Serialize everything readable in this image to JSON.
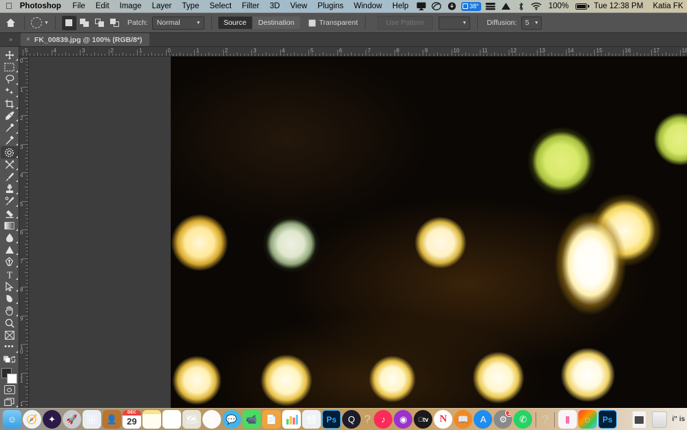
{
  "menubar": {
    "apple_icon": "apple-icon",
    "items": [
      {
        "label": "Photoshop",
        "bold": true
      },
      {
        "label": "File"
      },
      {
        "label": "Edit"
      },
      {
        "label": "Image"
      },
      {
        "label": "Layer"
      },
      {
        "label": "Type"
      },
      {
        "label": "Select"
      },
      {
        "label": "Filter"
      },
      {
        "label": "3D"
      },
      {
        "label": "View"
      },
      {
        "label": "Plugins"
      },
      {
        "label": "Window"
      },
      {
        "label": "Help"
      }
    ],
    "status": {
      "airplay_icon": "airplay-icon",
      "creative_cloud_icon": "creative-cloud-icon",
      "dropbox_icon": "dropbox-icon",
      "temperature": "38°",
      "temperature_color": "#1877e0",
      "stack_icon": "stack-icon",
      "onedrive_icon": "onedrive-icon",
      "bluetooth_icon": "bluetooth-icon",
      "wifi_icon": "wifi-icon",
      "battery_percent": "100%",
      "battery_icon": "battery-charging-icon",
      "clock": "Tue 12:38 PM",
      "user": "Katia FK",
      "search_icon": "search-icon",
      "control_center_icon": "control-center-icon"
    }
  },
  "options_bar": {
    "home_icon": "home-icon",
    "tool_preset": "patch-tool-preset",
    "selection_modes": [
      {
        "name": "new-selection",
        "active": true
      },
      {
        "name": "add-to-selection",
        "active": false
      },
      {
        "name": "subtract-from-selection",
        "active": false
      },
      {
        "name": "intersect-with-selection",
        "active": false
      }
    ],
    "patch_label": "Patch:",
    "patch_value": "Normal",
    "source_label": "Source",
    "destination_label": "Destination",
    "source_active": true,
    "transparent_label": "Transparent",
    "transparent_checked": false,
    "use_pattern_label": "Use Pattern",
    "use_pattern_enabled": false,
    "pattern_swatch": "",
    "diffusion_label": "Diffusion:",
    "diffusion_value": "5"
  },
  "tab_bar": {
    "panel_toggle_icon": "expand-panels-icon",
    "document": {
      "close_icon": "×",
      "title": "FK_00839.jpg @ 100% (RGB/8*)"
    }
  },
  "toolbar": {
    "tools": [
      {
        "name": "move-tool",
        "glyph": "✥",
        "has_flyout": true,
        "active": false
      },
      {
        "name": "rectangular-marquee-tool",
        "glyph": "▢",
        "has_flyout": true,
        "active": false
      },
      {
        "name": "lasso-tool",
        "glyph": "◯",
        "has_flyout": true,
        "active": false
      },
      {
        "name": "object-selection-tool",
        "glyph": "✦",
        "has_flyout": true,
        "active": false
      },
      {
        "name": "crop-tool",
        "glyph": "⌗",
        "has_flyout": true,
        "active": false
      },
      {
        "name": "eyedropper-tool",
        "glyph": "⌁",
        "has_flyout": true,
        "active": false
      },
      {
        "name": "spot-healing-brush-tool",
        "glyph": "✎",
        "has_flyout": true,
        "active": false
      },
      {
        "name": "healing-brush-tool",
        "glyph": "✐",
        "has_flyout": true,
        "active": false
      },
      {
        "name": "patch-tool",
        "glyph": "◌",
        "has_flyout": true,
        "active": true
      },
      {
        "name": "content-aware-move-tool",
        "glyph": "✂",
        "has_flyout": true,
        "active": false
      },
      {
        "name": "brush-tool",
        "glyph": "🖌",
        "has_flyout": true,
        "active": false
      },
      {
        "name": "clone-stamp-tool",
        "glyph": "⎙",
        "has_flyout": true,
        "active": false
      },
      {
        "name": "history-brush-tool",
        "glyph": "✒",
        "has_flyout": true,
        "active": false
      },
      {
        "name": "eraser-tool",
        "glyph": "◨",
        "has_flyout": true,
        "active": false
      },
      {
        "name": "gradient-tool",
        "glyph": "▤",
        "has_flyout": true,
        "active": false
      },
      {
        "name": "blur-tool",
        "glyph": "💧",
        "has_flyout": true,
        "active": false
      },
      {
        "name": "dodge-tool",
        "glyph": "▲",
        "has_flyout": true,
        "active": false
      },
      {
        "name": "pen-tool",
        "glyph": "✑",
        "has_flyout": true,
        "active": false
      },
      {
        "name": "type-tool",
        "glyph": "T",
        "has_flyout": true,
        "active": false
      },
      {
        "name": "path-selection-tool",
        "glyph": "⟋",
        "has_flyout": true,
        "active": false
      },
      {
        "name": "shape-tool",
        "glyph": "▻",
        "has_flyout": true,
        "active": false
      },
      {
        "name": "hand-tool",
        "glyph": "✋",
        "has_flyout": true,
        "active": false
      },
      {
        "name": "zoom-tool",
        "glyph": "⌕",
        "has_flyout": false,
        "active": false
      },
      {
        "name": "edit-toolbar-button",
        "glyph": "⊠",
        "has_flyout": false,
        "active": false
      },
      {
        "name": "more-tools-button",
        "glyph": "•••",
        "has_flyout": false,
        "active": false
      }
    ],
    "default_colors_icon": "default-colors-icon",
    "swap_colors_icon": "swap-colors-icon",
    "foreground_color": "#2b2b2b",
    "background_color": "#ffffff",
    "quick_mask_icon": "quick-mask-icon",
    "screen_mode_icon": "screen-mode-icon"
  },
  "rulers": {
    "horizontal_labels": [
      "5",
      "4",
      "3",
      "2",
      "1",
      "0",
      "1",
      "2",
      "3",
      "4",
      "5",
      "6",
      "7",
      "8",
      "9",
      "10",
      "11",
      "12",
      "13",
      "14",
      "15",
      "16",
      "17",
      "18"
    ],
    "vertical_labels": [
      "0",
      "1",
      "2",
      "3",
      "4",
      "5",
      "6",
      "7",
      "8",
      "9",
      "10",
      "11",
      "1"
    ],
    "unit": "inches"
  },
  "canvas": {
    "zoom": "100%",
    "image_description": "blurred night bokeh photograph with warm yellow and white light orbs on dark background"
  },
  "dock": {
    "items": [
      {
        "name": "finder",
        "label": "Finder",
        "glyph": "☺",
        "bg": "#3fa9f5",
        "round": false,
        "running": true
      },
      {
        "name": "safari",
        "label": "Safari",
        "glyph": "🧭",
        "bg": "#eef4fa",
        "round": true,
        "running": true
      },
      {
        "name": "siri",
        "label": "Siri",
        "glyph": "✦",
        "bg": "#2b1a46",
        "round": true,
        "running": false
      },
      {
        "name": "launchpad",
        "label": "Launchpad",
        "glyph": "🚀",
        "bg": "#c9ccd1",
        "round": true,
        "running": false
      },
      {
        "name": "preview",
        "label": "Preview",
        "glyph": "🖼",
        "bg": "#e9eef3",
        "round": false,
        "running": false
      },
      {
        "name": "contacts",
        "label": "Contacts",
        "glyph": "👤",
        "bg": "#b9742f",
        "round": false,
        "running": false
      },
      {
        "name": "calendar",
        "label": "Calendar",
        "month": "DEC",
        "day": "29",
        "bg": "#ffffff",
        "round": false,
        "running": false
      },
      {
        "name": "notes",
        "label": "Notes",
        "glyph": "",
        "bg": "#fdf3c6",
        "round": false,
        "running": false
      },
      {
        "name": "reminders",
        "label": "Reminders",
        "glyph": "☰",
        "bg": "#ffffff",
        "round": false,
        "running": false
      },
      {
        "name": "maps",
        "label": "Maps",
        "glyph": "🗺",
        "bg": "#e6e3d8",
        "round": false,
        "running": false
      },
      {
        "name": "photos",
        "label": "Photos",
        "glyph": "✿",
        "bg": "#fbfbfb",
        "round": true,
        "running": false
      },
      {
        "name": "messages",
        "label": "Messages",
        "glyph": "💬",
        "bg": "#3fb5f0",
        "round": true,
        "running": false
      },
      {
        "name": "facetime",
        "label": "FaceTime",
        "glyph": "📹",
        "bg": "#4cd964",
        "round": false,
        "running": false
      },
      {
        "name": "pages",
        "label": "Pages",
        "glyph": "📄",
        "bg": "#f3a33c",
        "round": false,
        "running": false
      },
      {
        "name": "numbers",
        "label": "Numbers",
        "glyph": "📊",
        "bg": "#ffffff",
        "round": false,
        "running": false
      },
      {
        "name": "keynote",
        "label": "Keynote",
        "glyph": "📽",
        "bg": "#eef1f4",
        "round": false,
        "running": false
      },
      {
        "name": "photoshop-app",
        "label": "Ps",
        "glyph": "Ps",
        "bg": "#001e36",
        "round": false,
        "running": false
      },
      {
        "name": "quicktime",
        "label": "QuickTime",
        "glyph": "Q",
        "bg": "#1c1c2a",
        "round": true,
        "running": false
      },
      {
        "name": "unknown-app-1",
        "label": "?",
        "glyph": "?",
        "bg": "transparent",
        "round": false,
        "running": false
      },
      {
        "name": "itunes",
        "label": "iTunes",
        "glyph": "♪",
        "bg": "#fb2b5a",
        "round": true,
        "running": false
      },
      {
        "name": "podcasts",
        "label": "Podcasts",
        "glyph": "◉",
        "bg": "#9933cc",
        "round": true,
        "running": false
      },
      {
        "name": "apple-tv",
        "label": "Apple TV",
        "glyph": "tv",
        "bg": "#1a1a1a",
        "round": true,
        "running": false
      },
      {
        "name": "news",
        "label": "News",
        "glyph": "N",
        "bg": "#ffffff",
        "round": true,
        "running": false
      },
      {
        "name": "books",
        "label": "Books",
        "glyph": "📖",
        "bg": "#f08a24",
        "round": true,
        "running": false
      },
      {
        "name": "app-store",
        "label": "App Store",
        "glyph": "A",
        "bg": "#1e8df0",
        "round": true,
        "running": false
      },
      {
        "name": "system-preferences",
        "label": "System Preferences",
        "glyph": "⚙",
        "bg": "#8a8a8a",
        "round": true,
        "running": false,
        "badge": "1"
      },
      {
        "name": "whatsapp",
        "label": "WhatsApp",
        "glyph": "✆",
        "bg": "#25d366",
        "round": true,
        "running": false
      },
      {
        "name": "unknown-app-2",
        "label": "?",
        "glyph": "?",
        "bg": "transparent",
        "round": false,
        "running": false
      },
      {
        "name": "airdrop-display",
        "label": "Display",
        "glyph": "▭",
        "bg": "#f6f6f8",
        "round": false,
        "running": false
      },
      {
        "name": "creative-cloud",
        "label": "Creative Cloud",
        "glyph": "◎",
        "bg": "#e84b2c",
        "round": false,
        "running": true
      },
      {
        "name": "photoshop-running",
        "label": "Ps",
        "glyph": "Ps",
        "bg": "#001e36",
        "round": false,
        "running": true
      },
      {
        "name": "unknown-app-3",
        "label": "?",
        "glyph": "?",
        "bg": "transparent",
        "round": false,
        "running": false
      },
      {
        "name": "downloads-stack",
        "label": "Downloads",
        "glyph": "",
        "bg": "transparent",
        "round": false,
        "running": false
      },
      {
        "name": "trash",
        "label": "Trash",
        "glyph": "",
        "bg": "transparent",
        "round": false,
        "running": false
      }
    ],
    "notification_text": "i\" is "
  }
}
